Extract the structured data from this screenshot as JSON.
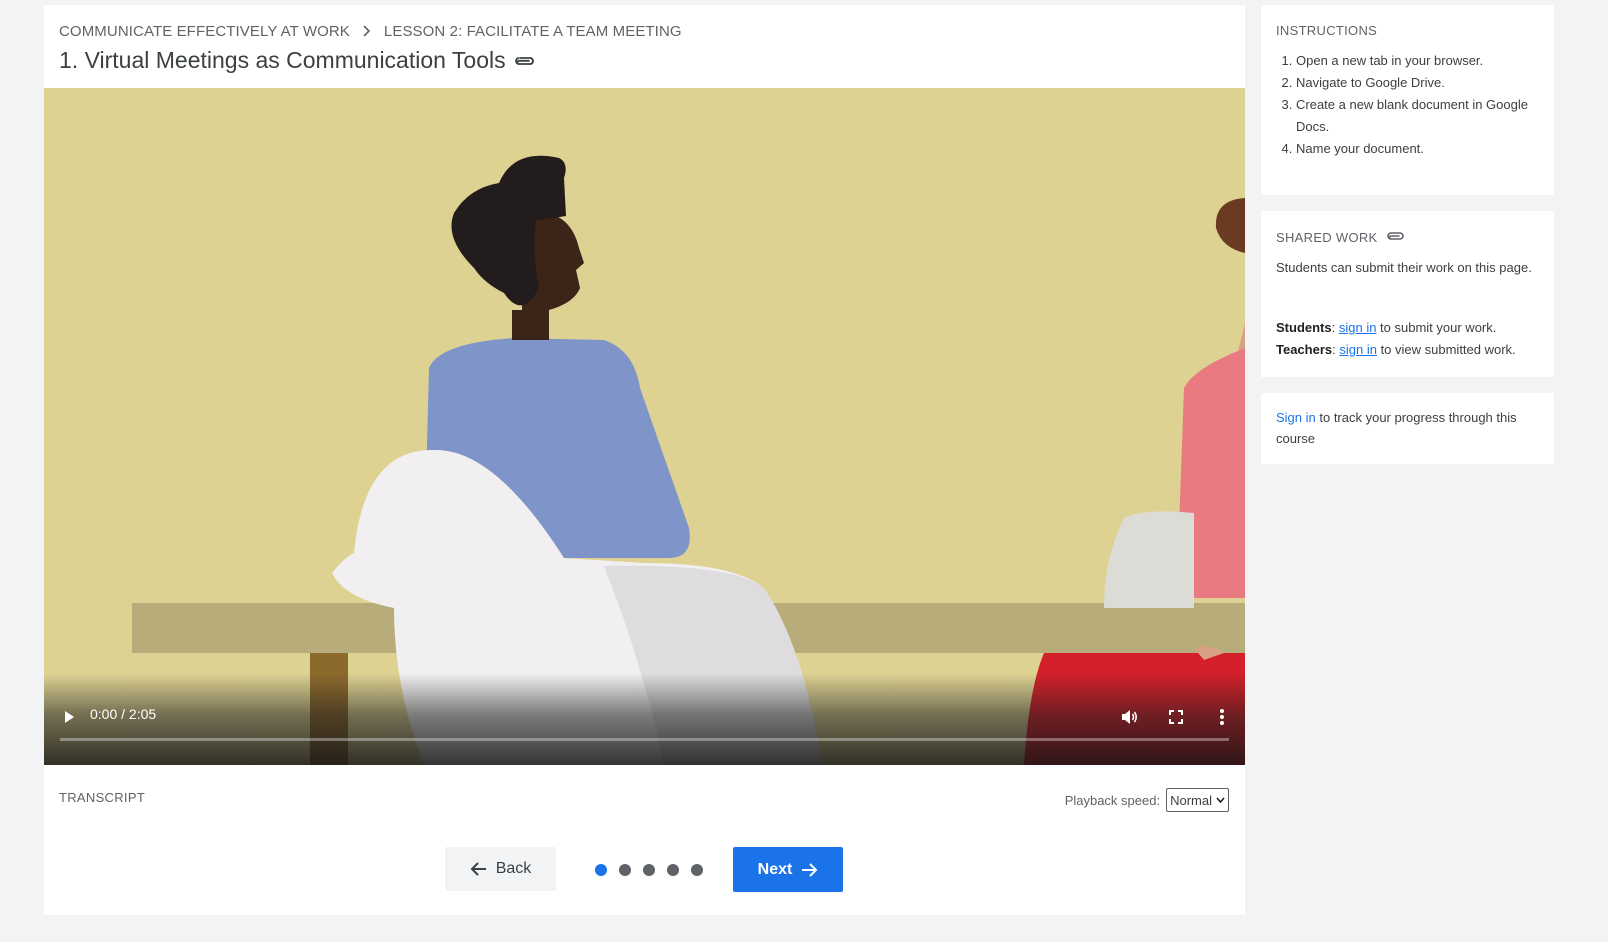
{
  "breadcrumb": {
    "course": "COMMUNICATE EFFECTIVELY AT WORK",
    "lesson": "LESSON 2: FACILITATE A TEAM MEETING"
  },
  "page_title": "1. Virtual Meetings as Communication Tools",
  "video": {
    "time": "0:00 / 2:05",
    "progress_fraction": 0,
    "icons": [
      "play-icon",
      "volume-icon",
      "fullscreen-icon",
      "more-vert-icon"
    ]
  },
  "transcript_label": "TRANSCRIPT",
  "playback": {
    "label": "Playback speed:",
    "selected": "Normal"
  },
  "nav": {
    "back_label": "Back",
    "next_label": "Next",
    "step_count": 5,
    "current_step": 1
  },
  "instructions": {
    "heading": "INSTRUCTIONS",
    "steps": [
      "Open a new tab in your browser.",
      "Navigate to Google Drive.",
      "Create a new blank document in Google Docs.",
      "Name your document."
    ]
  },
  "shared_work": {
    "heading": "SHARED WORK",
    "description": "Students can submit their work on this page.",
    "students_label": "Students",
    "students_link": "sign in",
    "students_rest": " to submit your work.",
    "teachers_label": "Teachers",
    "teachers_link": "sign in",
    "teachers_rest": " to view submitted work."
  },
  "progress": {
    "link": "Sign in",
    "rest": " to track your progress through this course"
  },
  "colors": {
    "accent": "#1a73e8",
    "background": "#f1f3f4",
    "video_wall": "#e1d596"
  }
}
